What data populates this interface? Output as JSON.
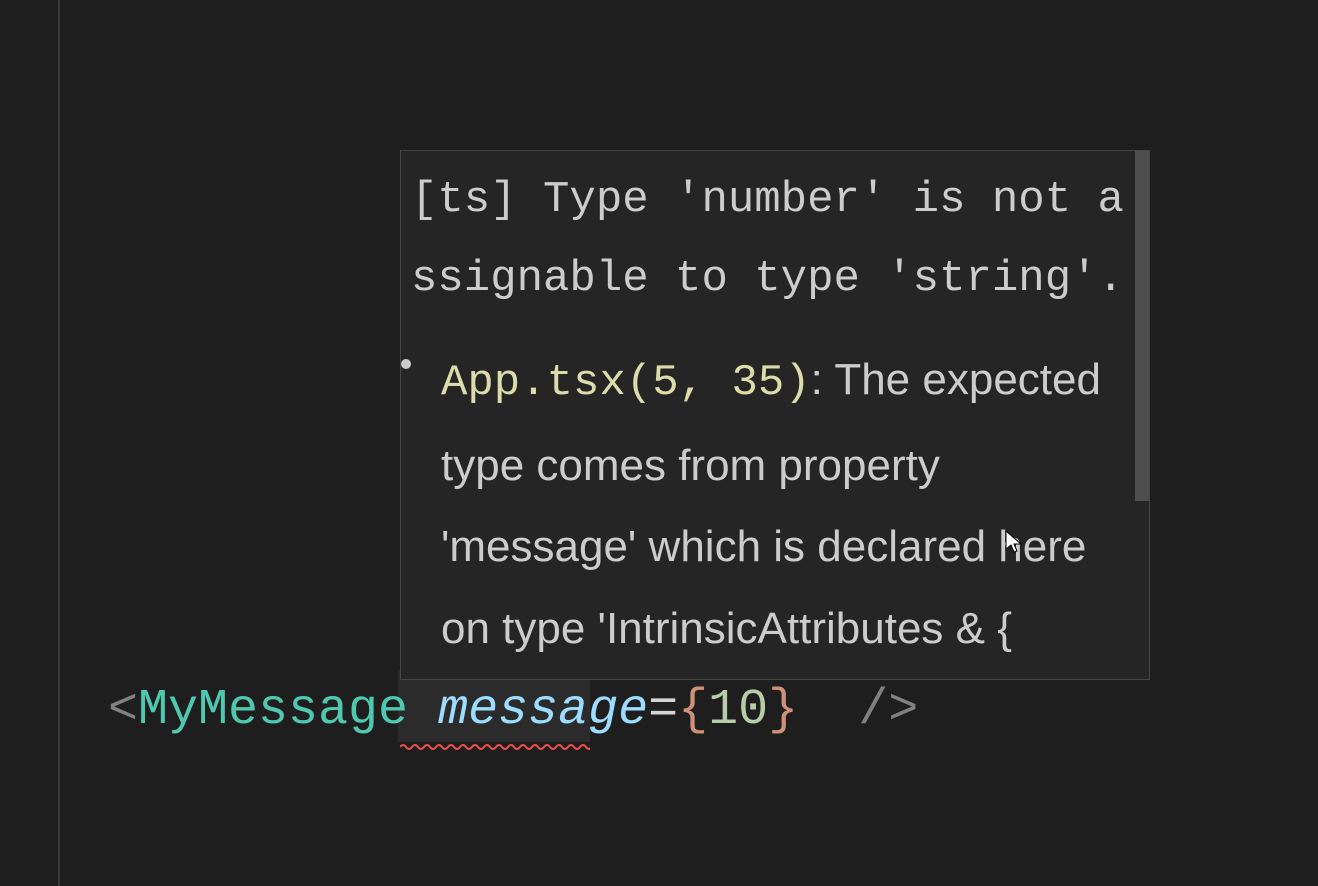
{
  "tooltip": {
    "error_message": "[ts] Type 'number' is not assignable to type 'string'.",
    "related": {
      "file_location": "App.tsx(5, 35)",
      "separator": ": ",
      "description": "The expected type comes from property 'message' which is declared here on type 'IntrinsicAttributes & {"
    }
  },
  "code": {
    "open_angle": "<",
    "component_name": "MyMessage",
    "space1": " ",
    "attribute": "message",
    "equals": "=",
    "brace_open": "{",
    "value": "10",
    "brace_close": "}",
    "space2": " ",
    "self_close": " />"
  }
}
